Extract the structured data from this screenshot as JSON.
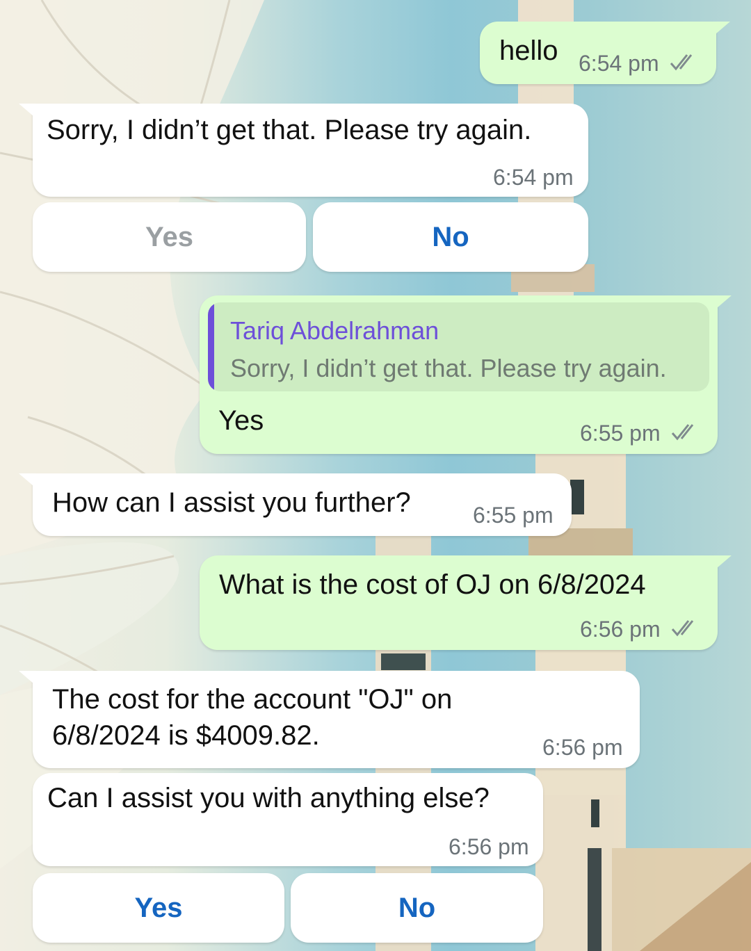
{
  "conversation": {
    "messages": [
      {
        "id": "m1",
        "direction": "outgoing",
        "text": "hello",
        "time": "6:54 pm",
        "status": "read"
      },
      {
        "id": "m2",
        "direction": "incoming",
        "text": "Sorry, I didn’t get that. Please try again.",
        "time": "6:54 pm",
        "quick_replies": [
          {
            "label": "Yes",
            "state": "disabled"
          },
          {
            "label": "No",
            "state": "enabled"
          }
        ]
      },
      {
        "id": "m3",
        "direction": "outgoing",
        "text": "Yes",
        "time": "6:55 pm",
        "status": "read",
        "reply_to": {
          "author": "Tariq Abdelrahman",
          "text": "Sorry, I didn’t get that. Please try again."
        }
      },
      {
        "id": "m4",
        "direction": "incoming",
        "text": "How can I assist you further?",
        "time": "6:55 pm"
      },
      {
        "id": "m5",
        "direction": "outgoing",
        "text": "What is the cost of OJ on 6/8/2024",
        "time": "6:56 pm",
        "status": "read"
      },
      {
        "id": "m6",
        "direction": "incoming",
        "text": "The cost for the account \"OJ\" on\n6/8/2024 is $4009.82.",
        "time": "6:56 pm"
      },
      {
        "id": "m7",
        "direction": "incoming",
        "text": "Can I assist you with anything else?",
        "time": "6:56 pm",
        "quick_replies": [
          {
            "label": "Yes",
            "state": "enabled"
          },
          {
            "label": "No",
            "state": "enabled"
          }
        ]
      }
    ]
  },
  "icons": {
    "read_receipt": "double-check-icon"
  },
  "colors": {
    "outgoing_bubble": "#dcfdd0",
    "incoming_bubble": "#ffffff",
    "quote_accent": "#6d4fd9",
    "quick_reply_active": "#1565c0",
    "quick_reply_disabled": "#9a9fa2"
  }
}
